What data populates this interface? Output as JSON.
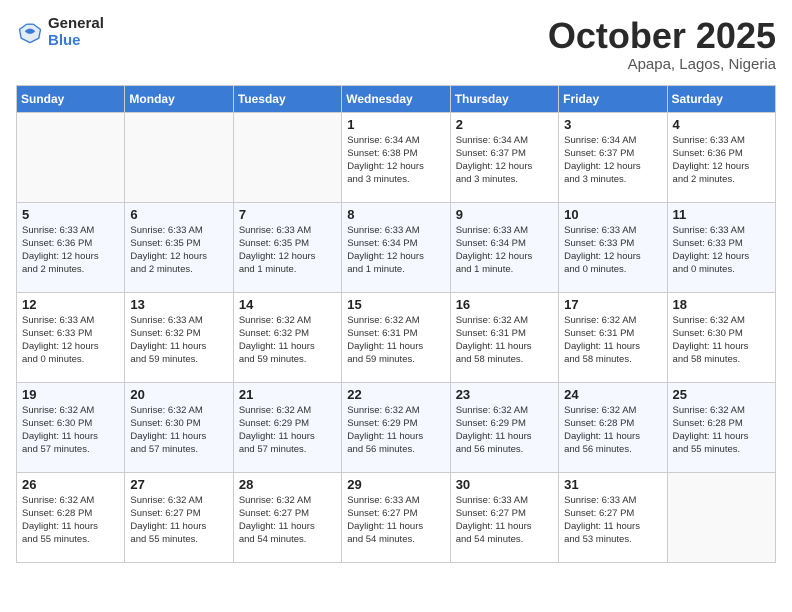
{
  "header": {
    "logo_general": "General",
    "logo_blue": "Blue",
    "month": "October 2025",
    "location": "Apapa, Lagos, Nigeria"
  },
  "weekdays": [
    "Sunday",
    "Monday",
    "Tuesday",
    "Wednesday",
    "Thursday",
    "Friday",
    "Saturday"
  ],
  "weeks": [
    [
      {
        "day": "",
        "info": ""
      },
      {
        "day": "",
        "info": ""
      },
      {
        "day": "",
        "info": ""
      },
      {
        "day": "1",
        "info": "Sunrise: 6:34 AM\nSunset: 6:38 PM\nDaylight: 12 hours\nand 3 minutes."
      },
      {
        "day": "2",
        "info": "Sunrise: 6:34 AM\nSunset: 6:37 PM\nDaylight: 12 hours\nand 3 minutes."
      },
      {
        "day": "3",
        "info": "Sunrise: 6:34 AM\nSunset: 6:37 PM\nDaylight: 12 hours\nand 3 minutes."
      },
      {
        "day": "4",
        "info": "Sunrise: 6:33 AM\nSunset: 6:36 PM\nDaylight: 12 hours\nand 2 minutes."
      }
    ],
    [
      {
        "day": "5",
        "info": "Sunrise: 6:33 AM\nSunset: 6:36 PM\nDaylight: 12 hours\nand 2 minutes."
      },
      {
        "day": "6",
        "info": "Sunrise: 6:33 AM\nSunset: 6:35 PM\nDaylight: 12 hours\nand 2 minutes."
      },
      {
        "day": "7",
        "info": "Sunrise: 6:33 AM\nSunset: 6:35 PM\nDaylight: 12 hours\nand 1 minute."
      },
      {
        "day": "8",
        "info": "Sunrise: 6:33 AM\nSunset: 6:34 PM\nDaylight: 12 hours\nand 1 minute."
      },
      {
        "day": "9",
        "info": "Sunrise: 6:33 AM\nSunset: 6:34 PM\nDaylight: 12 hours\nand 1 minute."
      },
      {
        "day": "10",
        "info": "Sunrise: 6:33 AM\nSunset: 6:33 PM\nDaylight: 12 hours\nand 0 minutes."
      },
      {
        "day": "11",
        "info": "Sunrise: 6:33 AM\nSunset: 6:33 PM\nDaylight: 12 hours\nand 0 minutes."
      }
    ],
    [
      {
        "day": "12",
        "info": "Sunrise: 6:33 AM\nSunset: 6:33 PM\nDaylight: 12 hours\nand 0 minutes."
      },
      {
        "day": "13",
        "info": "Sunrise: 6:33 AM\nSunset: 6:32 PM\nDaylight: 11 hours\nand 59 minutes."
      },
      {
        "day": "14",
        "info": "Sunrise: 6:32 AM\nSunset: 6:32 PM\nDaylight: 11 hours\nand 59 minutes."
      },
      {
        "day": "15",
        "info": "Sunrise: 6:32 AM\nSunset: 6:31 PM\nDaylight: 11 hours\nand 59 minutes."
      },
      {
        "day": "16",
        "info": "Sunrise: 6:32 AM\nSunset: 6:31 PM\nDaylight: 11 hours\nand 58 minutes."
      },
      {
        "day": "17",
        "info": "Sunrise: 6:32 AM\nSunset: 6:31 PM\nDaylight: 11 hours\nand 58 minutes."
      },
      {
        "day": "18",
        "info": "Sunrise: 6:32 AM\nSunset: 6:30 PM\nDaylight: 11 hours\nand 58 minutes."
      }
    ],
    [
      {
        "day": "19",
        "info": "Sunrise: 6:32 AM\nSunset: 6:30 PM\nDaylight: 11 hours\nand 57 minutes."
      },
      {
        "day": "20",
        "info": "Sunrise: 6:32 AM\nSunset: 6:30 PM\nDaylight: 11 hours\nand 57 minutes."
      },
      {
        "day": "21",
        "info": "Sunrise: 6:32 AM\nSunset: 6:29 PM\nDaylight: 11 hours\nand 57 minutes."
      },
      {
        "day": "22",
        "info": "Sunrise: 6:32 AM\nSunset: 6:29 PM\nDaylight: 11 hours\nand 56 minutes."
      },
      {
        "day": "23",
        "info": "Sunrise: 6:32 AM\nSunset: 6:29 PM\nDaylight: 11 hours\nand 56 minutes."
      },
      {
        "day": "24",
        "info": "Sunrise: 6:32 AM\nSunset: 6:28 PM\nDaylight: 11 hours\nand 56 minutes."
      },
      {
        "day": "25",
        "info": "Sunrise: 6:32 AM\nSunset: 6:28 PM\nDaylight: 11 hours\nand 55 minutes."
      }
    ],
    [
      {
        "day": "26",
        "info": "Sunrise: 6:32 AM\nSunset: 6:28 PM\nDaylight: 11 hours\nand 55 minutes."
      },
      {
        "day": "27",
        "info": "Sunrise: 6:32 AM\nSunset: 6:27 PM\nDaylight: 11 hours\nand 55 minutes."
      },
      {
        "day": "28",
        "info": "Sunrise: 6:32 AM\nSunset: 6:27 PM\nDaylight: 11 hours\nand 54 minutes."
      },
      {
        "day": "29",
        "info": "Sunrise: 6:33 AM\nSunset: 6:27 PM\nDaylight: 11 hours\nand 54 minutes."
      },
      {
        "day": "30",
        "info": "Sunrise: 6:33 AM\nSunset: 6:27 PM\nDaylight: 11 hours\nand 54 minutes."
      },
      {
        "day": "31",
        "info": "Sunrise: 6:33 AM\nSunset: 6:27 PM\nDaylight: 11 hours\nand 53 minutes."
      },
      {
        "day": "",
        "info": ""
      }
    ]
  ]
}
